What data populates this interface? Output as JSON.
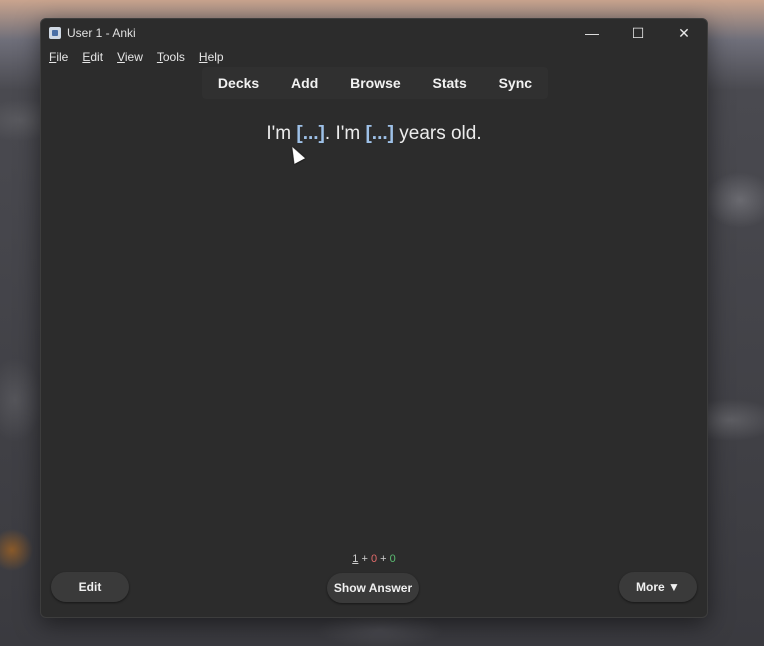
{
  "window": {
    "title": "User 1 - Anki"
  },
  "window_controls": {
    "minimize": "—",
    "maximize": "☐",
    "close": "✕"
  },
  "menu": [
    {
      "label": "File",
      "mnemonic": "F",
      "rest": "ile"
    },
    {
      "label": "Edit",
      "mnemonic": "E",
      "rest": "dit"
    },
    {
      "label": "View",
      "mnemonic": "V",
      "rest": "iew"
    },
    {
      "label": "Tools",
      "mnemonic": "T",
      "rest": "ools"
    },
    {
      "label": "Help",
      "mnemonic": "H",
      "rest": "elp"
    }
  ],
  "toolbar": {
    "decks": "Decks",
    "add": "Add",
    "browse": "Browse",
    "stats": "Stats",
    "sync": "Sync"
  },
  "card": {
    "part1": "I'm ",
    "cloze1": "[...]",
    "part2": ". I'm ",
    "cloze2": "[...]",
    "part3": " years old."
  },
  "counts": {
    "new": "1",
    "learn": "0",
    "review": "0",
    "sep": " + "
  },
  "buttons": {
    "edit": "Edit",
    "show_answer": "Show Answer",
    "more": "More ▼"
  },
  "colors": {
    "background": "#2c2c2c",
    "cloze": "#9ec1e8",
    "learn": "#e36b6b",
    "review": "#5bbd72"
  }
}
